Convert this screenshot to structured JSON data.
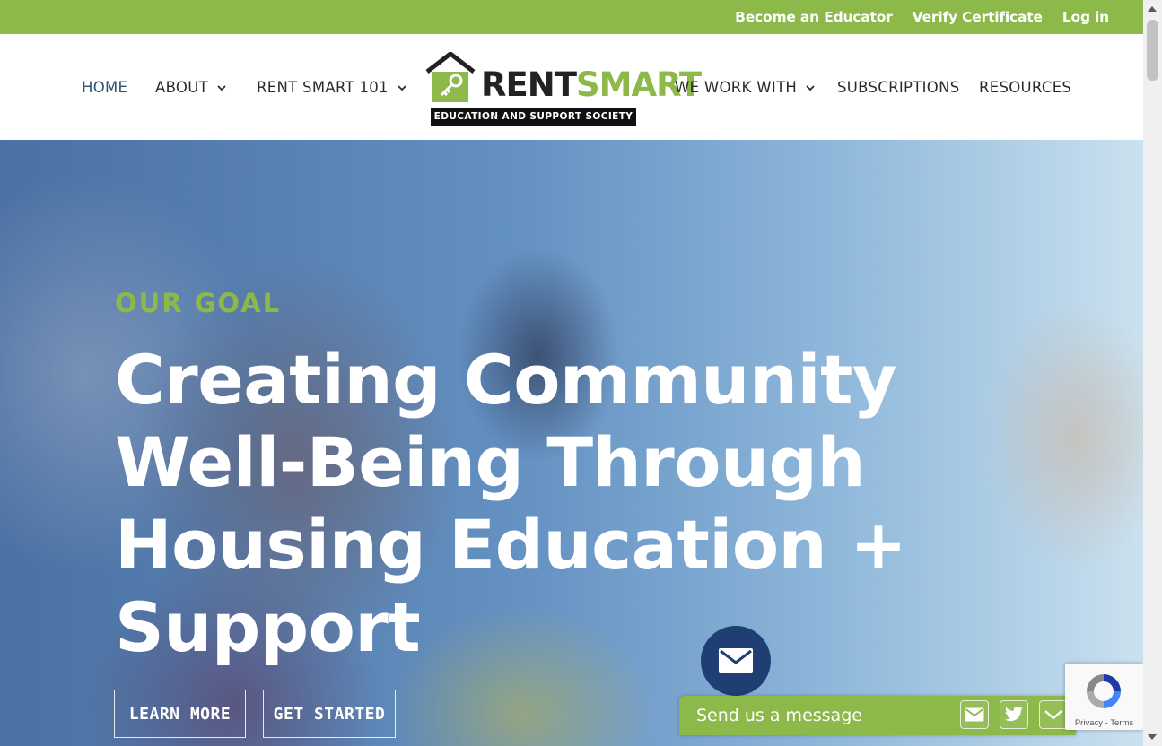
{
  "topbar": {
    "links": [
      "Become an Educator",
      "Verify Certificate",
      "Log in"
    ]
  },
  "nav": {
    "home": "HOME",
    "about": "ABOUT",
    "rent_smart_101": "RENT SMART 101",
    "we_work_with": "WE WORK WITH",
    "subscriptions": "SUBSCRIPTIONS",
    "resources": "RESOURCES"
  },
  "logo": {
    "rent": "RENT",
    "smart": "SMART",
    "tagline": "EDUCATION AND SUPPORT SOCIETY"
  },
  "hero": {
    "eyebrow": "OUR GOAL",
    "headline": "Creating Community Well-Being Through Housing Education + Support",
    "learn_more": "LEARN MORE",
    "get_started": "GET STARTED"
  },
  "message_bar": {
    "label": "Send us a message"
  },
  "recaptcha": {
    "privacy": "Privacy",
    "separator": " - ",
    "terms": "Terms"
  },
  "colors": {
    "brand_green": "#8db84a",
    "nav_active": "#2e4f7a",
    "mail_button": "#1f3e73"
  }
}
